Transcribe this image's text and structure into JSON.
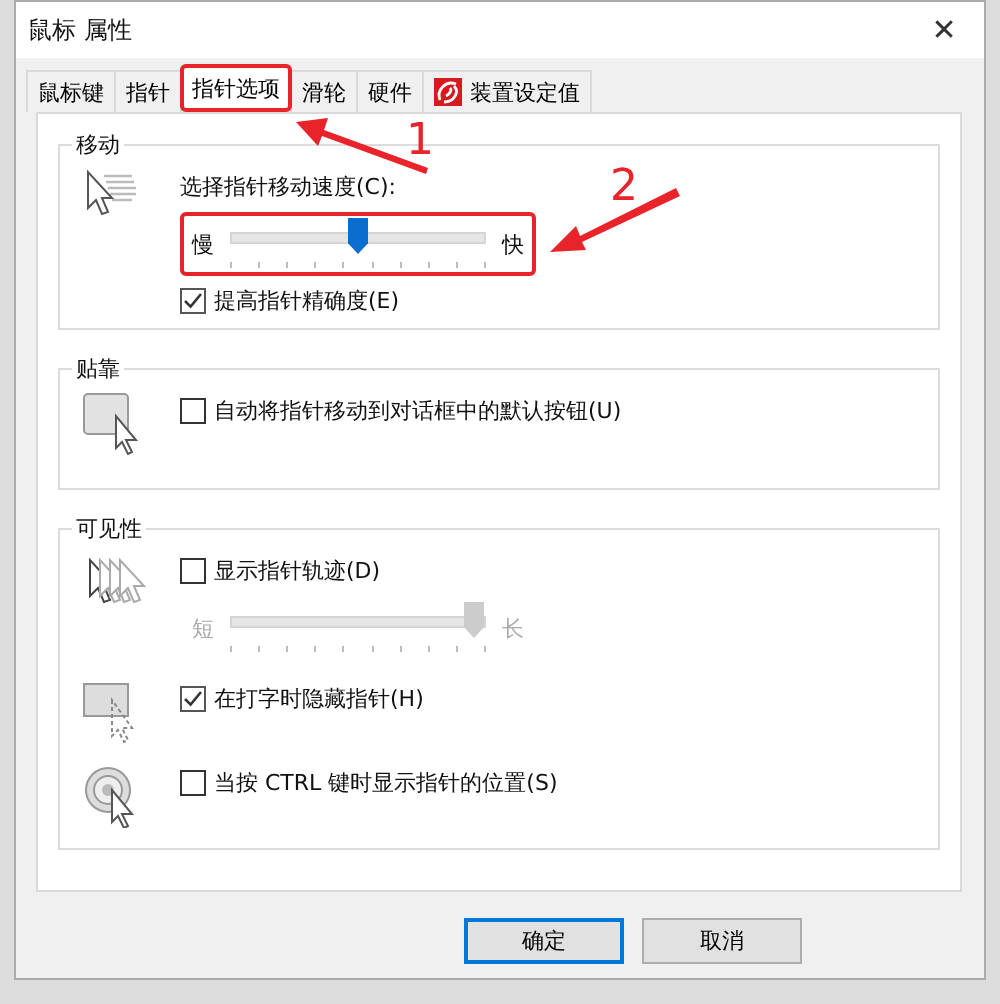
{
  "window": {
    "title": "鼠标 属性",
    "close": "✕"
  },
  "tabs": [
    {
      "label": "鼠标键",
      "selected": false,
      "highlighted": false,
      "kind": "text"
    },
    {
      "label": "指针",
      "selected": false,
      "highlighted": false,
      "kind": "text"
    },
    {
      "label": "指针选项",
      "selected": true,
      "highlighted": true,
      "kind": "text"
    },
    {
      "label": "滑轮",
      "selected": false,
      "highlighted": false,
      "kind": "text"
    },
    {
      "label": "硬件",
      "selected": false,
      "highlighted": false,
      "kind": "text"
    },
    {
      "label": "装置设定值",
      "selected": false,
      "highlighted": false,
      "kind": "logo"
    }
  ],
  "groups": [
    {
      "title": "移动",
      "blocks": [
        {
          "controls": [
            {
              "kind": "label",
              "label": "选择指针移动速度(C):"
            },
            {
              "kind": "slider",
              "min_label": "慢",
              "max_label": "快",
              "level": 0.5,
              "disabled": false,
              "highlighted": true
            },
            {
              "kind": "checkbox",
              "label": "提高指针精确度(E)",
              "checked": true
            }
          ]
        }
      ]
    },
    {
      "title": "贴靠",
      "blocks": [
        {
          "controls": [
            {
              "kind": "checkbox",
              "label": "自动将指针移动到对话框中的默认按钮(U)",
              "checked": false
            }
          ]
        }
      ]
    },
    {
      "title": "可见性",
      "blocks": [
        {
          "controls": [
            {
              "kind": "checkbox",
              "label": "显示指针轨迹(D)",
              "checked": false
            },
            {
              "kind": "slider",
              "min_label": "短",
              "max_label": "长",
              "level": 1,
              "disabled": true,
              "highlighted": false
            }
          ]
        },
        {
          "controls": [
            {
              "kind": "checkbox",
              "label": "在打字时隐藏指针(H)",
              "checked": true
            }
          ]
        },
        {
          "controls": [
            {
              "kind": "checkbox",
              "label": "当按 CTRL 键时显示指针的位置(S)",
              "checked": false
            }
          ]
        }
      ]
    }
  ],
  "buttons": [
    {
      "label": "确定",
      "default": true
    },
    {
      "label": "取消",
      "default": false
    }
  ],
  "annotations": [
    {
      "label": "1"
    },
    {
      "label": "2"
    }
  ]
}
